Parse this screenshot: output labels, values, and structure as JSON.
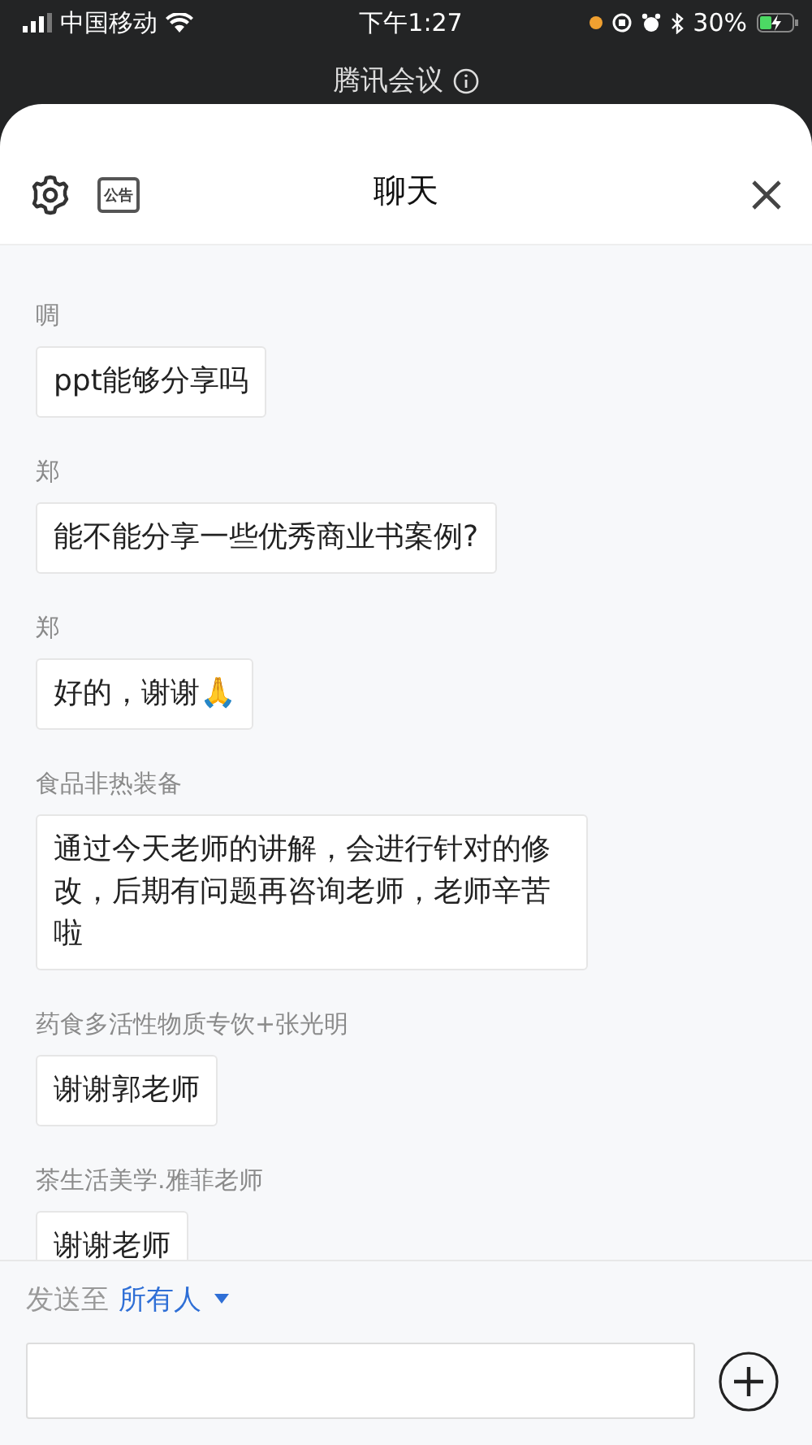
{
  "status_bar": {
    "carrier": "中国移动",
    "time": "下午1:27",
    "battery": "30%"
  },
  "background_app": {
    "title": "腾讯会议"
  },
  "header": {
    "title": "聊天",
    "notice_icon_text": "公告"
  },
  "messages": [
    {
      "sender": "啁",
      "text": "ppt能够分享吗"
    },
    {
      "sender": "郑",
      "text": "能不能分享一些优秀商业书案例?"
    },
    {
      "sender": "郑",
      "text": "好的，谢谢🙏"
    },
    {
      "sender": "食品非热装备",
      "text": "通过今天老师的讲解，会进行针对的修改，后期有问题再咨询老师，老师辛苦啦"
    },
    {
      "sender": "药食多活性物质专饮+张光明",
      "text": "谢谢郭老师"
    },
    {
      "sender": "茶生活美学.雅菲老师",
      "text": "谢谢老师"
    }
  ],
  "composer": {
    "send_to_label": "发送至",
    "recipient": "所有人"
  }
}
